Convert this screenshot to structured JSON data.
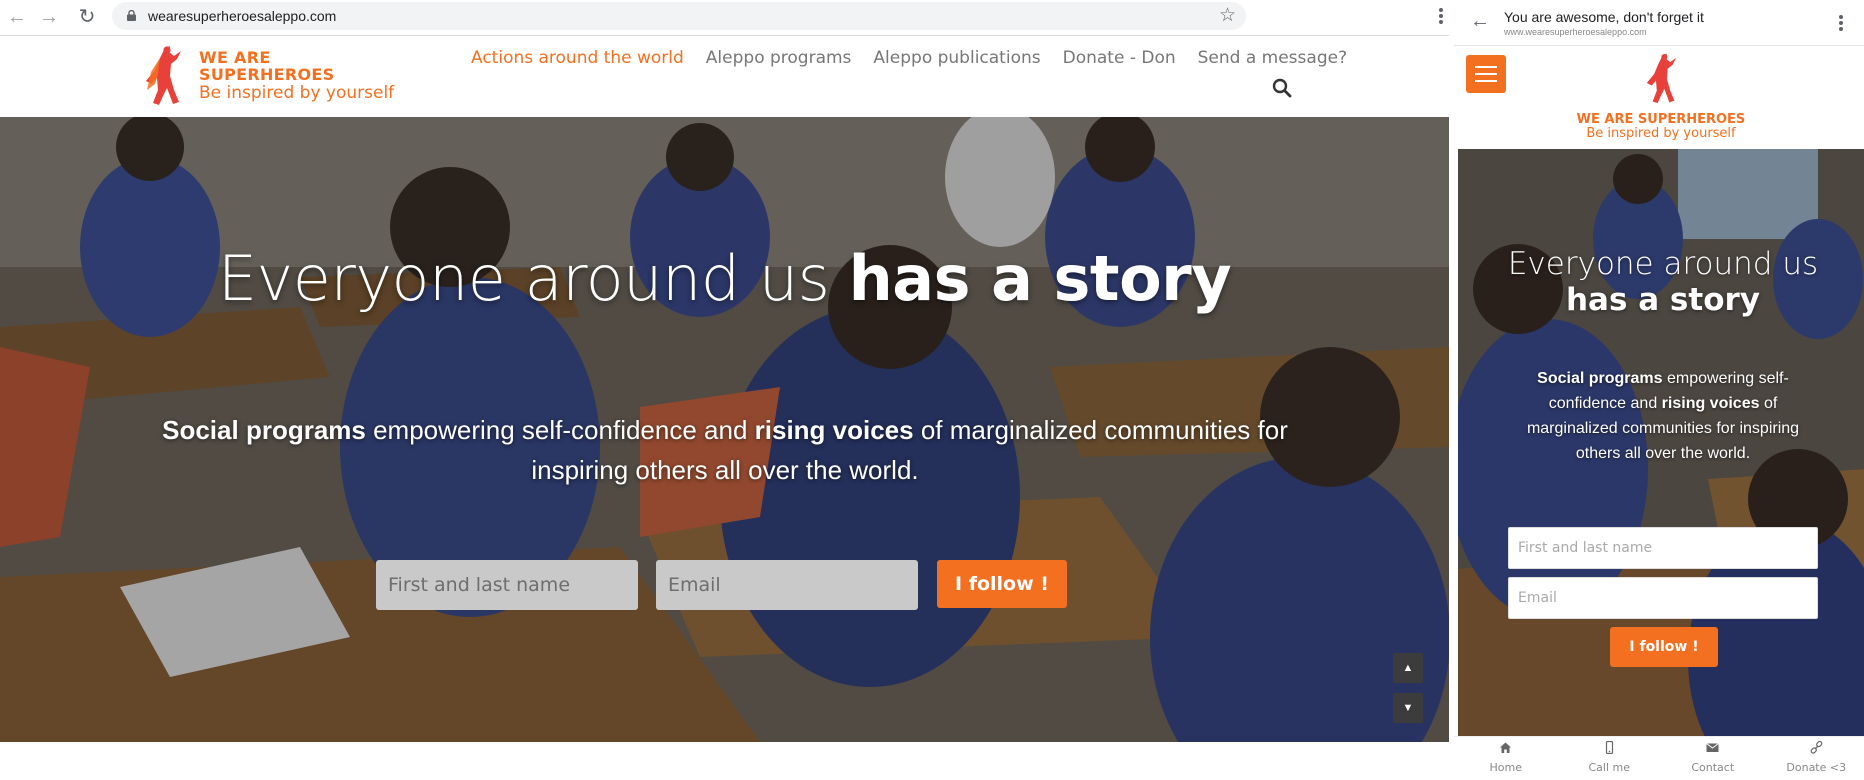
{
  "browser": {
    "url": "wearesuperheroesaleppo.com"
  },
  "site": {
    "logo_line1": "WE ARE",
    "logo_line2": "SUPERHEROES",
    "logo_tagline": "Be inspired by yourself",
    "menu": [
      {
        "label": "Actions around the world",
        "active": true
      },
      {
        "label": "Aleppo programs",
        "active": false
      },
      {
        "label": "Aleppo publications",
        "active": false
      },
      {
        "label": "Donate - Don",
        "active": false
      },
      {
        "label": "Send a message?",
        "active": false
      }
    ]
  },
  "hero": {
    "title_light": "Everyone around us ",
    "title_bold": "has a story",
    "sub_bold1": "Social programs",
    "sub_text1": " empowering self-confidence and ",
    "sub_bold2": "rising voices",
    "sub_text2": " of marginalized communities for inspiring others all over the world.",
    "name_placeholder": "First and last name",
    "email_placeholder": "Email",
    "follow_label": "I follow !"
  },
  "mobile": {
    "page_title": "You are awesome, don't forget it",
    "page_url": "www.wearesuperheroesaleppo.com",
    "logo_line": "WE ARE SUPERHEROES",
    "logo_tagline": "Be inspired by yourself",
    "title_light": "Everyone around us",
    "title_bold": "has a story",
    "sub_bold1": "Social programs",
    "sub_text1": " empowering self-confidence and ",
    "sub_bold2": "rising voices",
    "sub_text2": " of marginalized communities for inspiring others all over the world.",
    "name_placeholder": "First and last name",
    "email_placeholder": "Email",
    "follow_label": "I follow !",
    "tabs": [
      {
        "label": "Home",
        "icon": "home-icon"
      },
      {
        "label": "Call me",
        "icon": "phone-icon"
      },
      {
        "label": "Contact",
        "icon": "mail-icon"
      },
      {
        "label": "Donate <3",
        "icon": "link-icon"
      }
    ]
  },
  "colors": {
    "accent": "#f37021",
    "menu_text": "#777777"
  }
}
